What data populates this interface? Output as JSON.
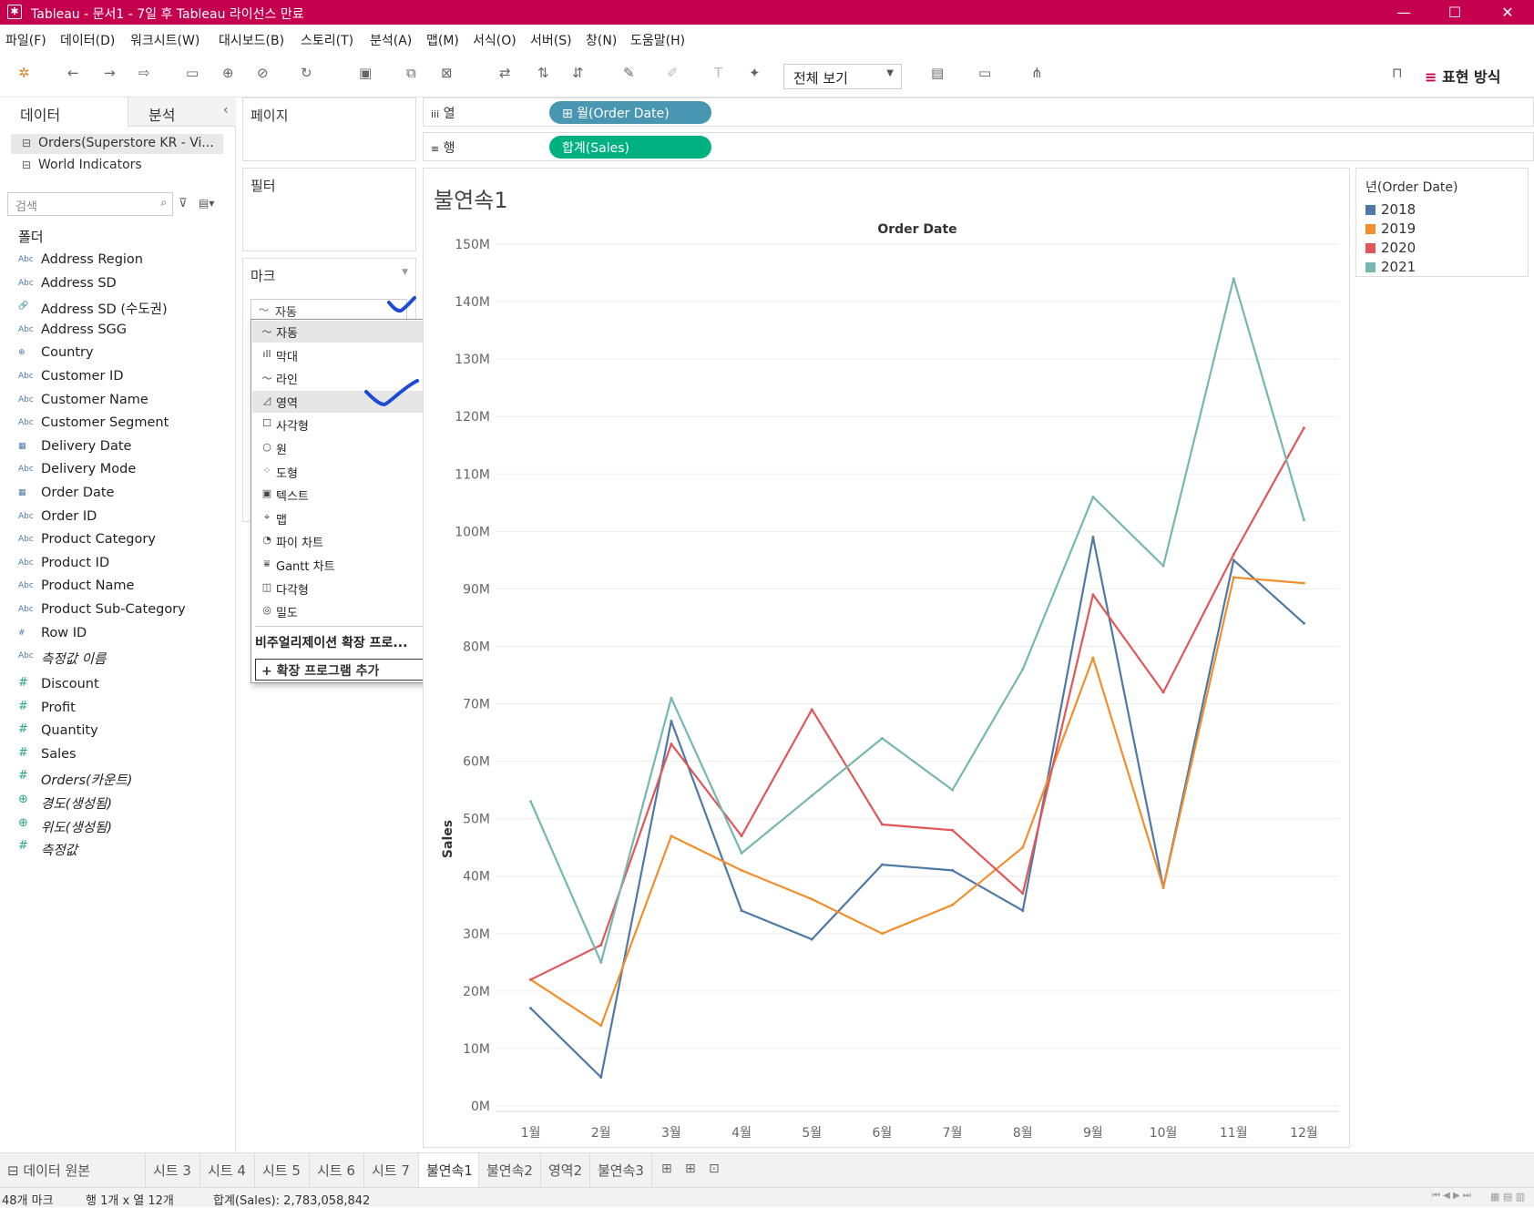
{
  "window": {
    "title": "Tableau - 문서1 - 7일 후 Tableau 라이선스 만료",
    "controls": [
      "—",
      "☐",
      "✕"
    ]
  },
  "menu": [
    "파일(F)",
    "데이터(D)",
    "워크시트(W)",
    "대시보드(B)",
    "스토리(T)",
    "분석(A)",
    "맵(M)",
    "서식(O)",
    "서버(S)",
    "창(N)",
    "도움말(H)"
  ],
  "toolbar": {
    "view_select": "전체 보기",
    "show_me": "표현 방식"
  },
  "data_pane": {
    "tab_data": "데이터",
    "tab_analysis": "분석",
    "collapse": "‹",
    "sources": [
      "Orders(Superstore KR - Vi...",
      "World Indicators"
    ],
    "search_placeholder": "검색",
    "folder_label": "폴더",
    "dimensions": [
      {
        "icon": "Abc",
        "name": "Address Region"
      },
      {
        "icon": "Abc",
        "name": "Address SD"
      },
      {
        "icon": "🔗",
        "name": "Address SD (수도권)"
      },
      {
        "icon": "Abc",
        "name": "Address SGG"
      },
      {
        "icon": "⊕",
        "name": "Country"
      },
      {
        "icon": "Abc",
        "name": "Customer ID"
      },
      {
        "icon": "Abc",
        "name": "Customer Name"
      },
      {
        "icon": "Abc",
        "name": "Customer Segment"
      },
      {
        "icon": "▦",
        "name": "Delivery Date"
      },
      {
        "icon": "Abc",
        "name": "Delivery Mode"
      },
      {
        "icon": "▦",
        "name": "Order Date"
      },
      {
        "icon": "Abc",
        "name": "Order ID"
      },
      {
        "icon": "Abc",
        "name": "Product Category"
      },
      {
        "icon": "Abc",
        "name": "Product ID"
      },
      {
        "icon": "Abc",
        "name": "Product Name"
      },
      {
        "icon": "Abc",
        "name": "Product Sub-Category"
      },
      {
        "icon": "#",
        "name": "Row ID"
      },
      {
        "icon": "Abc",
        "name": "측정값 이름"
      }
    ],
    "measures": [
      {
        "icon": "#",
        "name": "Discount"
      },
      {
        "icon": "#",
        "name": "Profit"
      },
      {
        "icon": "#",
        "name": "Quantity"
      },
      {
        "icon": "#",
        "name": "Sales"
      },
      {
        "icon": "#",
        "name": "Orders(카운트)"
      },
      {
        "icon": "⊕",
        "name": "경도(생성됨)"
      },
      {
        "icon": "⊕",
        "name": "위도(생성됨)"
      },
      {
        "icon": "#",
        "name": "측정값"
      }
    ]
  },
  "cards": {
    "pages": "페이지",
    "filters": "필터",
    "marks": "마크",
    "mark_type_current": "자동",
    "mark_menu": [
      {
        "icon": "〜",
        "label": "자동"
      },
      {
        "icon": "ıll",
        "label": "막대"
      },
      {
        "icon": "〜",
        "label": "라인"
      },
      {
        "icon": "◿",
        "label": "영역"
      },
      {
        "icon": "☐",
        "label": "사각형"
      },
      {
        "icon": "○",
        "label": "원"
      },
      {
        "icon": "⁘",
        "label": "도형"
      },
      {
        "icon": "▣",
        "label": "텍스트"
      },
      {
        "icon": "⌖",
        "label": "맵"
      },
      {
        "icon": "◔",
        "label": "파이 차트"
      },
      {
        "icon": "⩸",
        "label": "Gantt 차트"
      },
      {
        "icon": "◫",
        "label": "다각형"
      },
      {
        "icon": "◎",
        "label": "밀도"
      }
    ],
    "extension_title": "비주얼리제이션 확장 프로...",
    "extension_add": "+ 확장 프로그램 추가"
  },
  "shelves": {
    "columns_label": "열",
    "rows_label": "행",
    "columns_pill": "⊞ 월(Order Date)",
    "rows_pill": "합계(Sales)"
  },
  "sheet_title": "불연속1",
  "legend": {
    "title": "년(Order Date)",
    "items": [
      "2018",
      "2019",
      "2020",
      "2021"
    ]
  },
  "colors": {
    "title_bar": "#c4004f",
    "pill_dimension": "#4996b2",
    "pill_measure": "#00b180",
    "check_mark": "#1a4ad6"
  },
  "chart_data": {
    "type": "line",
    "title": "",
    "xlabel": "Order Date",
    "ylabel": "Sales",
    "categories": [
      "1월",
      "2월",
      "3월",
      "4월",
      "5월",
      "6월",
      "7월",
      "8월",
      "9월",
      "10월",
      "11월",
      "12월"
    ],
    "yticks": [
      "0M",
      "10M",
      "20M",
      "30M",
      "40M",
      "50M",
      "60M",
      "70M",
      "80M",
      "90M",
      "100M",
      "110M",
      "120M",
      "130M",
      "140M",
      "150M"
    ],
    "ylim": [
      0,
      150000000
    ],
    "grid": true,
    "legend_position": "right",
    "series": [
      {
        "name": "2018",
        "color": "#4e79a7",
        "values": [
          17000000,
          5000000,
          67000000,
          34000000,
          29000000,
          42000000,
          41000000,
          34000000,
          99000000,
          38000000,
          95000000,
          84000000
        ]
      },
      {
        "name": "2019",
        "color": "#f28e2b",
        "values": [
          22000000,
          14000000,
          47000000,
          41000000,
          36000000,
          30000000,
          35000000,
          45000000,
          78000000,
          38000000,
          92000000,
          91000000
        ]
      },
      {
        "name": "2020",
        "color": "#e15759",
        "values": [
          22000000,
          28000000,
          63000000,
          47000000,
          69000000,
          49000000,
          48000000,
          37000000,
          89000000,
          72000000,
          96000000,
          118000000
        ]
      },
      {
        "name": "2021",
        "color": "#76b7b2",
        "values": [
          53000000,
          25000000,
          71000000,
          44000000,
          54000000,
          64000000,
          55000000,
          76000000,
          106000000,
          94000000,
          144000000,
          102000000
        ]
      }
    ]
  },
  "sheet_tabs": [
    "⊟ 데이터 원본",
    "시트 3",
    "시트 4",
    "시트 5",
    "시트 6",
    "시트 7",
    "불연속1",
    "불연속2",
    "영역2",
    "불연속3"
  ],
  "status": {
    "marks": "48개 마크",
    "rows_cols": "행 1개 x 열 12개",
    "sum": "합계(Sales): 2,783,058,842"
  }
}
